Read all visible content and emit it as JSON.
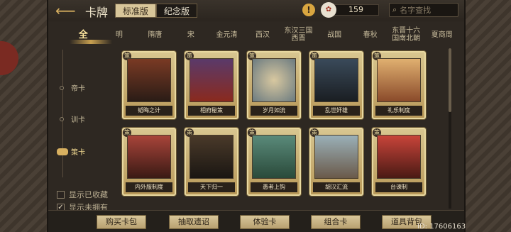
{
  "header": {
    "title": "卡牌",
    "version_tabs": [
      {
        "label": "标准版",
        "active": true
      },
      {
        "label": "纪念版",
        "active": false
      }
    ],
    "currency_value": "159",
    "search_placeholder": "名字查找"
  },
  "dynasty_tabs": [
    {
      "label": "全",
      "active": true
    },
    {
      "label": "明"
    },
    {
      "label": "隋唐"
    },
    {
      "label": "宋"
    },
    {
      "label": "金元清"
    },
    {
      "label": "西汉"
    },
    {
      "label": "东汉三国 西晋"
    },
    {
      "label": "战国"
    },
    {
      "label": "春秋"
    },
    {
      "label": "东晋十六 国南北朝"
    },
    {
      "label": "夏商周"
    }
  ],
  "categories": [
    {
      "label": "帝卡"
    },
    {
      "label": "训卡"
    },
    {
      "label": "策卡",
      "active": true
    }
  ],
  "filters": [
    {
      "label": "显示已收藏",
      "checked": false
    },
    {
      "label": "显示未拥有",
      "checked": true
    }
  ],
  "cards": [
    {
      "label": "韬晦之计",
      "badge": "策"
    },
    {
      "label": "相府秘策",
      "badge": "策"
    },
    {
      "label": "岁月如流",
      "badge": "策"
    },
    {
      "label": "乱世奸雄",
      "badge": "策"
    },
    {
      "label": "礼乐制度",
      "badge": "策"
    },
    {
      "label": "内外服制度",
      "badge": "策"
    },
    {
      "label": "天下归一",
      "badge": "策"
    },
    {
      "label": "愚者上钩",
      "badge": "策"
    },
    {
      "label": "胡汉汇流",
      "badge": "策"
    },
    {
      "label": "台谏制",
      "badge": "策"
    }
  ],
  "bottom_buttons": [
    {
      "label": "购买卡包"
    },
    {
      "label": "抽取遗诏"
    },
    {
      "label": "体验卡"
    },
    {
      "label": "组合卡"
    },
    {
      "label": "道具背包"
    }
  ],
  "user_id": "ID: 17606163",
  "colors": {
    "gold": "#d8b060",
    "panel": "#2e2822",
    "card_frame": "#d8c690"
  }
}
